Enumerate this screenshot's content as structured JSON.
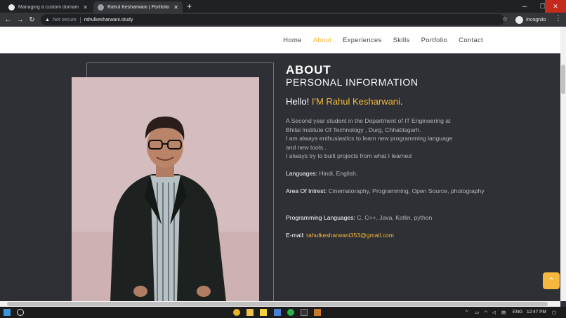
{
  "browser": {
    "tabs": [
      {
        "title": "Managing a custom domain for",
        "icon": "github-icon"
      },
      {
        "title": "Rahul Kesharwani | Portfolio",
        "icon": "globe-icon"
      }
    ],
    "security_label": "Not secure",
    "url": "rahulkesharwani.study",
    "profile_label": "Incognito"
  },
  "nav": {
    "items": [
      "Home",
      "About",
      "Experiences",
      "Skills",
      "Portfolio",
      "Contact"
    ],
    "active": "About"
  },
  "about": {
    "heading": "ABOUT",
    "subheading": "PERSONAL INFORMATION",
    "hello_prefix": "Hello!",
    "hello_name": "I'M Rahul Kesharwani",
    "hello_suffix": ".",
    "bio_lines": [
      "A Second year student in the Department of IT Engineering at",
      "Bhilai Institute Of Technology , Durg, Chhattisgarh.",
      "I am always enthusiastics to learn new programming language",
      "and new tools .",
      "I always try to built projects from what I learned"
    ],
    "languages_label": "Languages:",
    "languages_value": "Hindi, English.",
    "interest_label": "Area Of Intrest:",
    "interest_value": "Cinematoraphy, Programming, Open Source, photography",
    "prog_label": "Programming Languages:",
    "prog_value": "C, C++, Java, Kotlin, python",
    "email_label": "E-mail:",
    "email_value": "rahulkesharwani353@gmail.com"
  },
  "taskbar": {
    "lang": "ENG",
    "time": "12:47 PM"
  },
  "colors": {
    "accent": "#f5b83d",
    "background": "#2e3035"
  }
}
